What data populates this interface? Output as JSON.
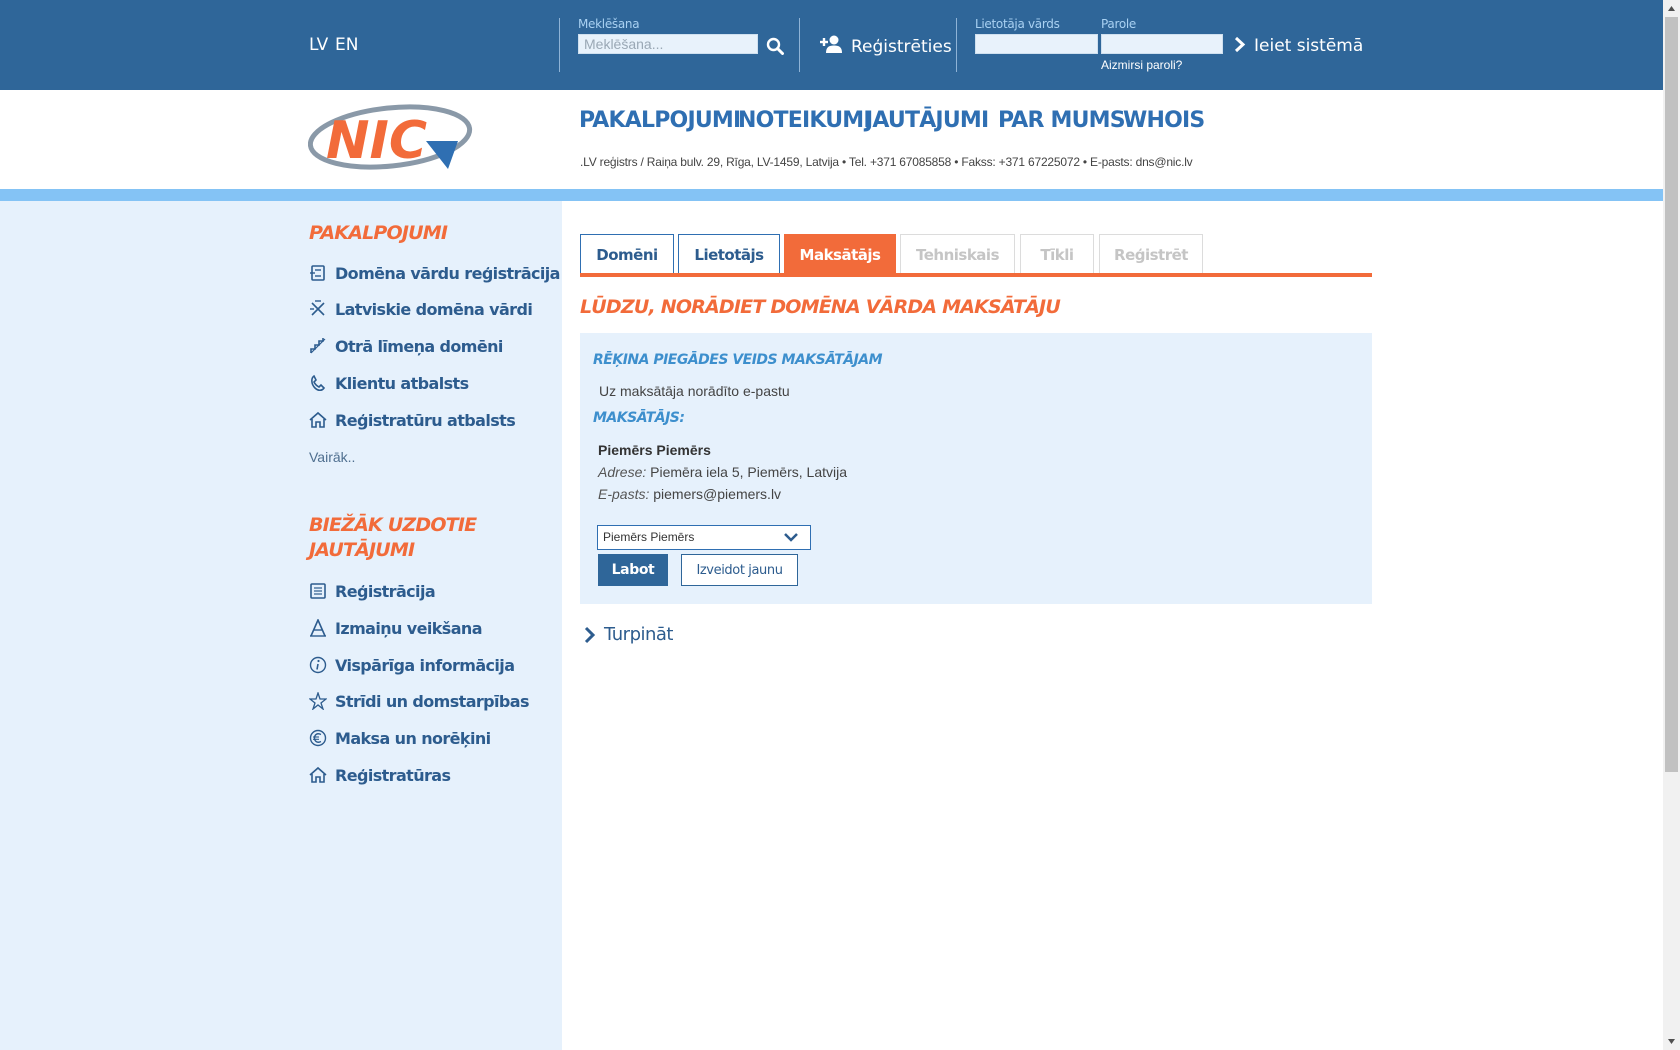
{
  "top": {
    "lang_lv": "LV",
    "lang_en": "EN",
    "search_label": "Meklēšana",
    "search_placeholder": "Meklēšana...",
    "register": "Reģistrēties",
    "username_label": "Lietotāja vārds",
    "password_label": "Parole",
    "forgot": "Aizmirsi paroli?",
    "login": "Ieiet sistēmā"
  },
  "header": {
    "logo_text": "NIC",
    "nav": [
      "PAKALPOJUMI",
      "NOTEIKUMI",
      "JAUTĀJUMI",
      "PAR MUMS",
      "WHOIS"
    ],
    "contact": ".LV reģistrs / Raiņa bulv. 29, Rīga, LV-1459, Latvija • Tel. +371 67085858 • Fakss: +371 67225072 • E-pasts: dns@nic.lv"
  },
  "sidebar": {
    "services_title": "PAKALPOJUMI",
    "services": [
      {
        "label": "Domēna vārdu reģistrācija",
        "icon": "domain-icon"
      },
      {
        "label": "Latviskie domēna vārdi",
        "icon": "latvian-letters-icon"
      },
      {
        "label": "Otrā līmeņa domēni",
        "icon": "stairs-icon"
      },
      {
        "label": "Klientu atbalsts",
        "icon": "phone-icon"
      },
      {
        "label": "Reģistratūru atbalsts",
        "icon": "house-icon"
      }
    ],
    "more": "Vairāk..",
    "faq_title_1": "BIEŽĀK UZDOTIE",
    "faq_title_2": "JAUTĀJUMI",
    "faq": [
      {
        "label": "Reģistrācija",
        "icon": "document-icon"
      },
      {
        "label": "Izmaiņu veikšana",
        "icon": "letter-a-icon"
      },
      {
        "label": "Vispārīga informācija",
        "icon": "info-icon"
      },
      {
        "label": "Strīdi un domstarpības",
        "icon": "spark-icon"
      },
      {
        "label": "Maksa un norēķini",
        "icon": "euro-icon"
      },
      {
        "label": "Reģistratūras",
        "icon": "house-icon"
      }
    ]
  },
  "tabs": [
    {
      "label": "Domēni",
      "state": "normal"
    },
    {
      "label": "Lietotājs",
      "state": "normal"
    },
    {
      "label": "Maksātājs",
      "state": "active"
    },
    {
      "label": "Tehniskais",
      "state": "disabled"
    },
    {
      "label": "Tīkli",
      "state": "disabled"
    },
    {
      "label": "Reģistrēt",
      "state": "disabled"
    }
  ],
  "main": {
    "title": "LŪDZU, NORĀDIET DOMĒNA VĀRDA MAKSĀTĀJU",
    "delivery_heading": "RĒĶINA PIEGĀDES VEIDS MAKSĀTĀJAM",
    "delivery_value": "Uz maksātāja norādīto e-pastu",
    "payer_heading": "MAKSĀTĀJS:",
    "payer_name": "Piemērs Piemērs",
    "address_label": "Adrese:",
    "address_value": "Piemēra iela 5, Piemērs, Latvija",
    "email_label": "E-pasts:",
    "email_value": "piemers@piemers.lv",
    "select_value": "Piemērs Piemērs",
    "edit_button": "Labot",
    "new_button": "Izveidot jaunu",
    "continue": "Turpināt"
  },
  "colors": {
    "topbar": "#2f6699",
    "accent": "#f26b3a",
    "link": "#2d5c8e",
    "sidebar_bg": "#e6f1fc",
    "stripe": "#84c3f5"
  }
}
